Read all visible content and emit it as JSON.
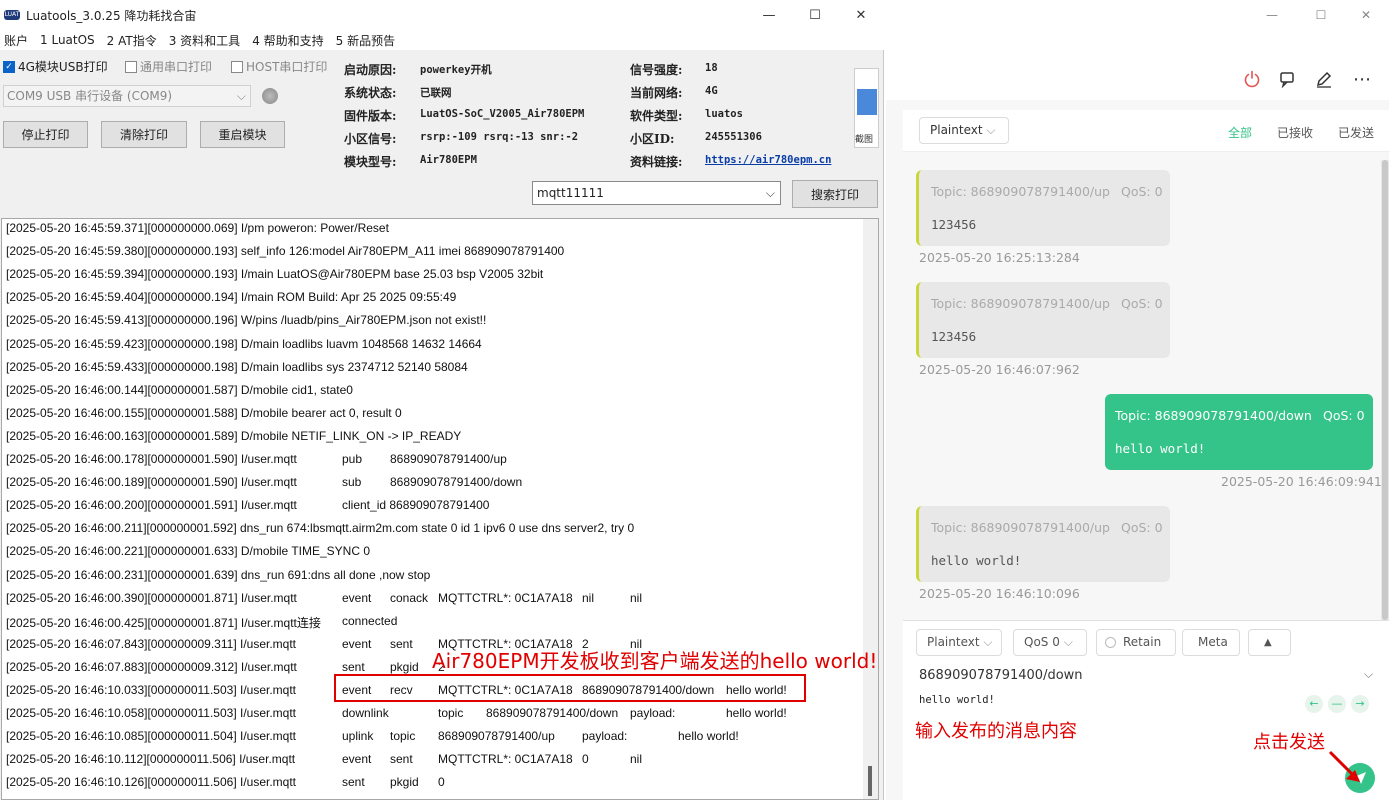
{
  "luatools": {
    "title": "Luatools_3.0.25 降功耗找合宙",
    "menu": [
      "账户",
      "1 LuatOS",
      "2 AT指令",
      "3 资料和工具",
      "4 帮助和支持",
      "5 新品预告"
    ],
    "checkboxes": [
      {
        "label": "4G模块USB打印",
        "checked": true
      },
      {
        "label": "通用串口打印",
        "checked": false
      },
      {
        "label": "HOST串口打印",
        "checked": false
      }
    ],
    "port": "COM9 USB 串行设备 (COM9)",
    "buttons": {
      "stop": "停止打印",
      "clear": "清除打印",
      "restart": "重启模块",
      "search": "搜索打印"
    },
    "info": {
      "boot_reason_k": "启动原因:",
      "boot_reason_v": "powerkey开机",
      "signal_k": "信号强度:",
      "signal_v": "18",
      "sys_state_k": "系统状态:",
      "sys_state_v": "已联网",
      "network_k": "当前网络:",
      "network_v": "4G",
      "firmware_k": "固件版本:",
      "firmware_v": "LuatOS-SoC_V2005_Air780EPM",
      "software_k": "软件类型:",
      "software_v": "luatos",
      "cell_k": "小区信号:",
      "cell_v": "rsrp:-109 rsrq:-13 snr:-2",
      "cellid_k": "小区ID:",
      "cellid_v": "245551306",
      "model_k": "模块型号:",
      "model_v": "Air780EPM",
      "link_k": "资料链接:",
      "link_v": "https://air780epm.cn"
    },
    "thumb_label": "截图",
    "search_value": "mqtt11111",
    "log": [
      [
        "[2025-05-20 16:45:59.371][000000000.069] I/pm poweron: Power/Reset"
      ],
      [
        "[2025-05-20 16:45:59.380][000000000.193] self_info 126:model Air780EPM_A11 imei 868909078791400"
      ],
      [
        "[2025-05-20 16:45:59.394][000000000.193] I/main LuatOS@Air780EPM base 25.03 bsp V2005 32bit"
      ],
      [
        "[2025-05-20 16:45:59.404][000000000.194] I/main ROM Build: Apr 25 2025 09:55:49"
      ],
      [
        "[2025-05-20 16:45:59.413][000000000.196] W/pins /luadb/pins_Air780EPM.json not exist!!"
      ],
      [
        "[2025-05-20 16:45:59.423][000000000.198] D/main loadlibs luavm 1048568 14632 14664"
      ],
      [
        "[2025-05-20 16:45:59.433][000000000.198] D/main loadlibs sys   2374712 52140 58084"
      ],
      [
        "[2025-05-20 16:46:00.144][000000001.587] D/mobile cid1, state0"
      ],
      [
        "[2025-05-20 16:46:00.155][000000001.588] D/mobile bearer act 0, result 0"
      ],
      [
        "[2025-05-20 16:46:00.163][000000001.589] D/mobile NETIF_LINK_ON -> IP_READY"
      ],
      [
        "[2025-05-20 16:46:00.178][000000001.590] I/user.mqtt",
        "pub",
        "868909078791400/up"
      ],
      [
        "[2025-05-20 16:46:00.189][000000001.590] I/user.mqtt",
        "sub",
        "868909078791400/down"
      ],
      [
        "[2025-05-20 16:46:00.200][000000001.591] I/user.mqtt",
        "client_id 868909078791400"
      ],
      [
        "[2025-05-20 16:46:00.211][000000001.592] dns_run 674:lbsmqtt.airm2m.com state 0 id 1 ipv6 0 use dns server2, try 0"
      ],
      [
        "[2025-05-20 16:46:00.221][000000001.633] D/mobile TIME_SYNC 0"
      ],
      [
        "[2025-05-20 16:46:00.231][000000001.639] dns_run 691:dns all done ,now stop"
      ],
      [
        "[2025-05-20 16:46:00.390][000000001.871] I/user.mqtt",
        "event",
        "conack",
        "MQTTCTRL*: 0C1A7A18",
        "nil",
        "nil"
      ],
      [
        "[2025-05-20 16:46:00.425][000000001.871] I/user.mqtt连接",
        "connected"
      ],
      [
        "[2025-05-20 16:46:07.843][000000009.311] I/user.mqtt",
        "event",
        "sent",
        "MQTTCTRL*: 0C1A7A18",
        "2",
        "nil"
      ],
      [
        "[2025-05-20 16:46:07.883][000000009.312] I/user.mqtt",
        "sent",
        "pkgid",
        "2"
      ],
      [
        "[2025-05-20 16:46:10.033][000000011.503] I/user.mqtt",
        "event",
        "recv",
        "MQTTCTRL*: 0C1A7A18",
        "868909078791400/down",
        "hello world!"
      ],
      [
        "[2025-05-20 16:46:10.058][000000011.503] I/user.mqtt",
        "downlink",
        "topic",
        "868909078791400/down",
        "payload:",
        "hello world!"
      ],
      [
        "[2025-05-20 16:46:10.085][000000011.504] I/user.mqtt",
        "uplink",
        "topic",
        "868909078791400/up",
        "payload:",
        "hello world!"
      ],
      [
        "[2025-05-20 16:46:10.112][000000011.506] I/user.mqtt",
        "event",
        "sent",
        "MQTTCTRL*: 0C1A7A18",
        "0",
        "nil"
      ],
      [
        "[2025-05-20 16:46:10.126][000000011.506] I/user.mqtt",
        "sent",
        "pkgid",
        "0"
      ]
    ],
    "annotation": "Air780EPM开发板收到客户端发送的hello world!"
  },
  "mqttx": {
    "format": "Plaintext",
    "filters": {
      "all": "全部",
      "received": "已接收",
      "sent": "已发送"
    },
    "messages": [
      {
        "topic": "Topic: 868909078791400/up",
        "qos": "QoS: 0",
        "body": "123456",
        "time": "2025-05-20 16:25:13:284",
        "dir": "in"
      },
      {
        "topic": "Topic: 868909078791400/up",
        "qos": "QoS: 0",
        "body": "123456",
        "time": "2025-05-20 16:46:07:962",
        "dir": "in"
      },
      {
        "topic": "Topic: 868909078791400/down",
        "qos": "QoS: 0",
        "body": "hello world!",
        "time": "2025-05-20 16:46:09:941",
        "dir": "out"
      },
      {
        "topic": "Topic: 868909078791400/up",
        "qos": "QoS: 0",
        "body": "hello world!",
        "time": "2025-05-20 16:46:10:096",
        "dir": "in"
      }
    ],
    "publish": {
      "format": "Plaintext",
      "qos": "QoS 0",
      "retain": "Retain",
      "meta": "Meta",
      "topic": "868909078791400/down",
      "payload": "hello world!"
    },
    "annot_input": "输入发布的消息内容",
    "annot_send": "点击发送",
    "colors": {
      "accent": "#34c388",
      "annotation": "#e10000"
    }
  }
}
